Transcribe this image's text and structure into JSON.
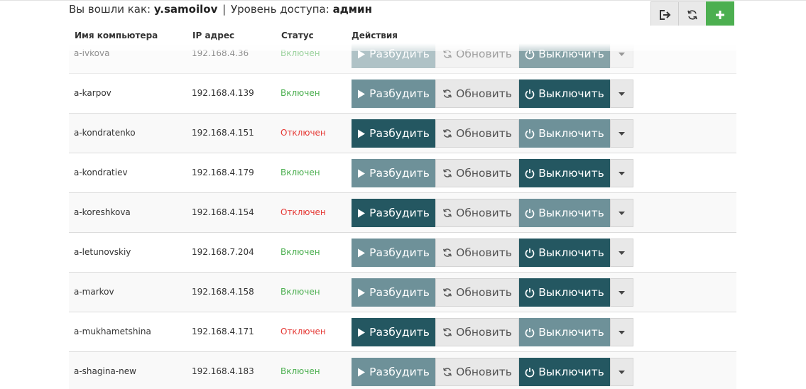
{
  "user": {
    "prefix": "Вы вошли как:",
    "username": "y.samoilov",
    "separator": "|",
    "access_label": "Уровень доступа:",
    "access_level": "админ"
  },
  "toolbar": {
    "logout_icon": "logout-icon",
    "refresh_icon": "refresh-icon",
    "add_icon": "plus-icon",
    "add_color": "#4caf50"
  },
  "table": {
    "headers": {
      "name": "Имя компьютера",
      "ip": "IP адрес",
      "status": "Статус",
      "actions": "Действия"
    },
    "actions": {
      "wake": "Разбудить",
      "refresh": "Обновить",
      "shutdown": "Выключить"
    },
    "colors": {
      "dark_button": "#245761",
      "muted_button": "#6e9199",
      "status_on": "#4caf50",
      "status_off": "#e53935"
    },
    "rows": [
      {
        "name": "a-ivkova",
        "ip": "192.168.4.36",
        "status": "Включен",
        "on": true
      },
      {
        "name": "a-karpov",
        "ip": "192.168.4.139",
        "status": "Включен",
        "on": true
      },
      {
        "name": "a-kondratenko",
        "ip": "192.168.4.151",
        "status": "Отключен",
        "on": false
      },
      {
        "name": "a-kondratiev",
        "ip": "192.168.4.179",
        "status": "Включен",
        "on": true
      },
      {
        "name": "a-koreshkova",
        "ip": "192.168.4.154",
        "status": "Отключен",
        "on": false
      },
      {
        "name": "a-letunovskiy",
        "ip": "192.168.7.204",
        "status": "Включен",
        "on": true
      },
      {
        "name": "a-markov",
        "ip": "192.168.4.158",
        "status": "Включен",
        "on": true
      },
      {
        "name": "a-mukhametshina",
        "ip": "192.168.4.171",
        "status": "Отключен",
        "on": false
      },
      {
        "name": "a-shagina-new",
        "ip": "192.168.4.183",
        "status": "Включен",
        "on": true
      }
    ]
  }
}
